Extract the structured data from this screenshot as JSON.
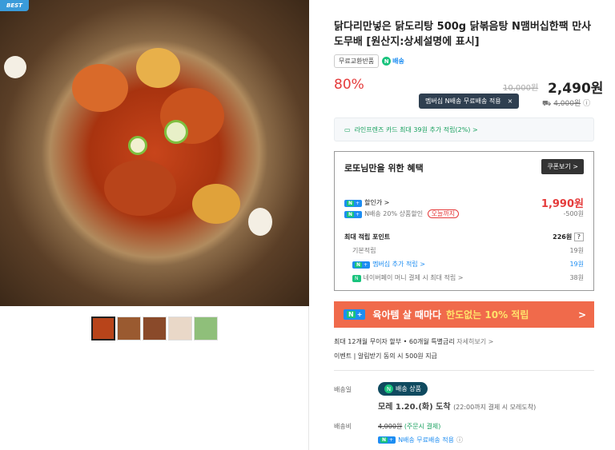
{
  "gallery": {
    "badge": "BEST",
    "main_image_alt": "dakdoritang food photo",
    "thumb_count": 5
  },
  "product": {
    "title": "닭다리만넣은 닭도리탕 500g 닭볶음탕 N맴버십한팩 만사도무배 [원산지:상세설명에 표시]",
    "tag_return": "무료교환반품",
    "tag_delivery": "배송",
    "discount": "80%",
    "original_price": "10,000원",
    "price": "2,490원"
  },
  "tooltip": {
    "text": "멤버십 N배송 무료배송 적용",
    "close": "×"
  },
  "shipping_fee_top": "4,000원",
  "card_promo": "라인프렌즈 카드 최대 39원 추가 적립(2%) >",
  "benefit": {
    "title": "로또님만을 위한 혜택",
    "coupon_button": "쿠폰보기 >",
    "sale_label": "할인가 >",
    "sale_price": "1,990원",
    "n_delivery_discount": "N배송 20% 상품할인",
    "today_tag": "오늘까지",
    "n_delivery_amount": "-500원",
    "points_label": "최대 적립 포인트",
    "points_value": "226원",
    "points_help": "?",
    "basic_label": "기본적립",
    "basic_value": "19원",
    "membership_label": "멤버십 추가 적립 >",
    "membership_value": "19원",
    "naverpay_label": "네이버페이 머니 결제 시 최대 적립 >",
    "naverpay_value": "38원"
  },
  "banner": {
    "prefix": "육아템 살 때마다",
    "highlight": "한도없는 10% 적립",
    "arrow": ">"
  },
  "installment": {
    "text": "최대 12개월 무이자 할부 • 60개월 특별금리",
    "link": "자세히보기 >"
  },
  "event": {
    "label": "이벤트",
    "text": "알림받기 동의 시 500원 지급"
  },
  "delivery": {
    "label": "배송일",
    "badge": "배송 상품",
    "date": "모레 1.20.(화) 도착",
    "date_sub": "(22:00까지 결제 시 모레도착)"
  },
  "fee": {
    "label": "배송비",
    "amount": "4,000원",
    "note": "(주문시 결제)",
    "n_text": "N배송 무료배송 적용"
  },
  "colors": {
    "accent_red": "#e53b3b",
    "naver_green": "#19c37d",
    "naver_blue": "#1d8df2",
    "banner": "#f06a4b"
  }
}
